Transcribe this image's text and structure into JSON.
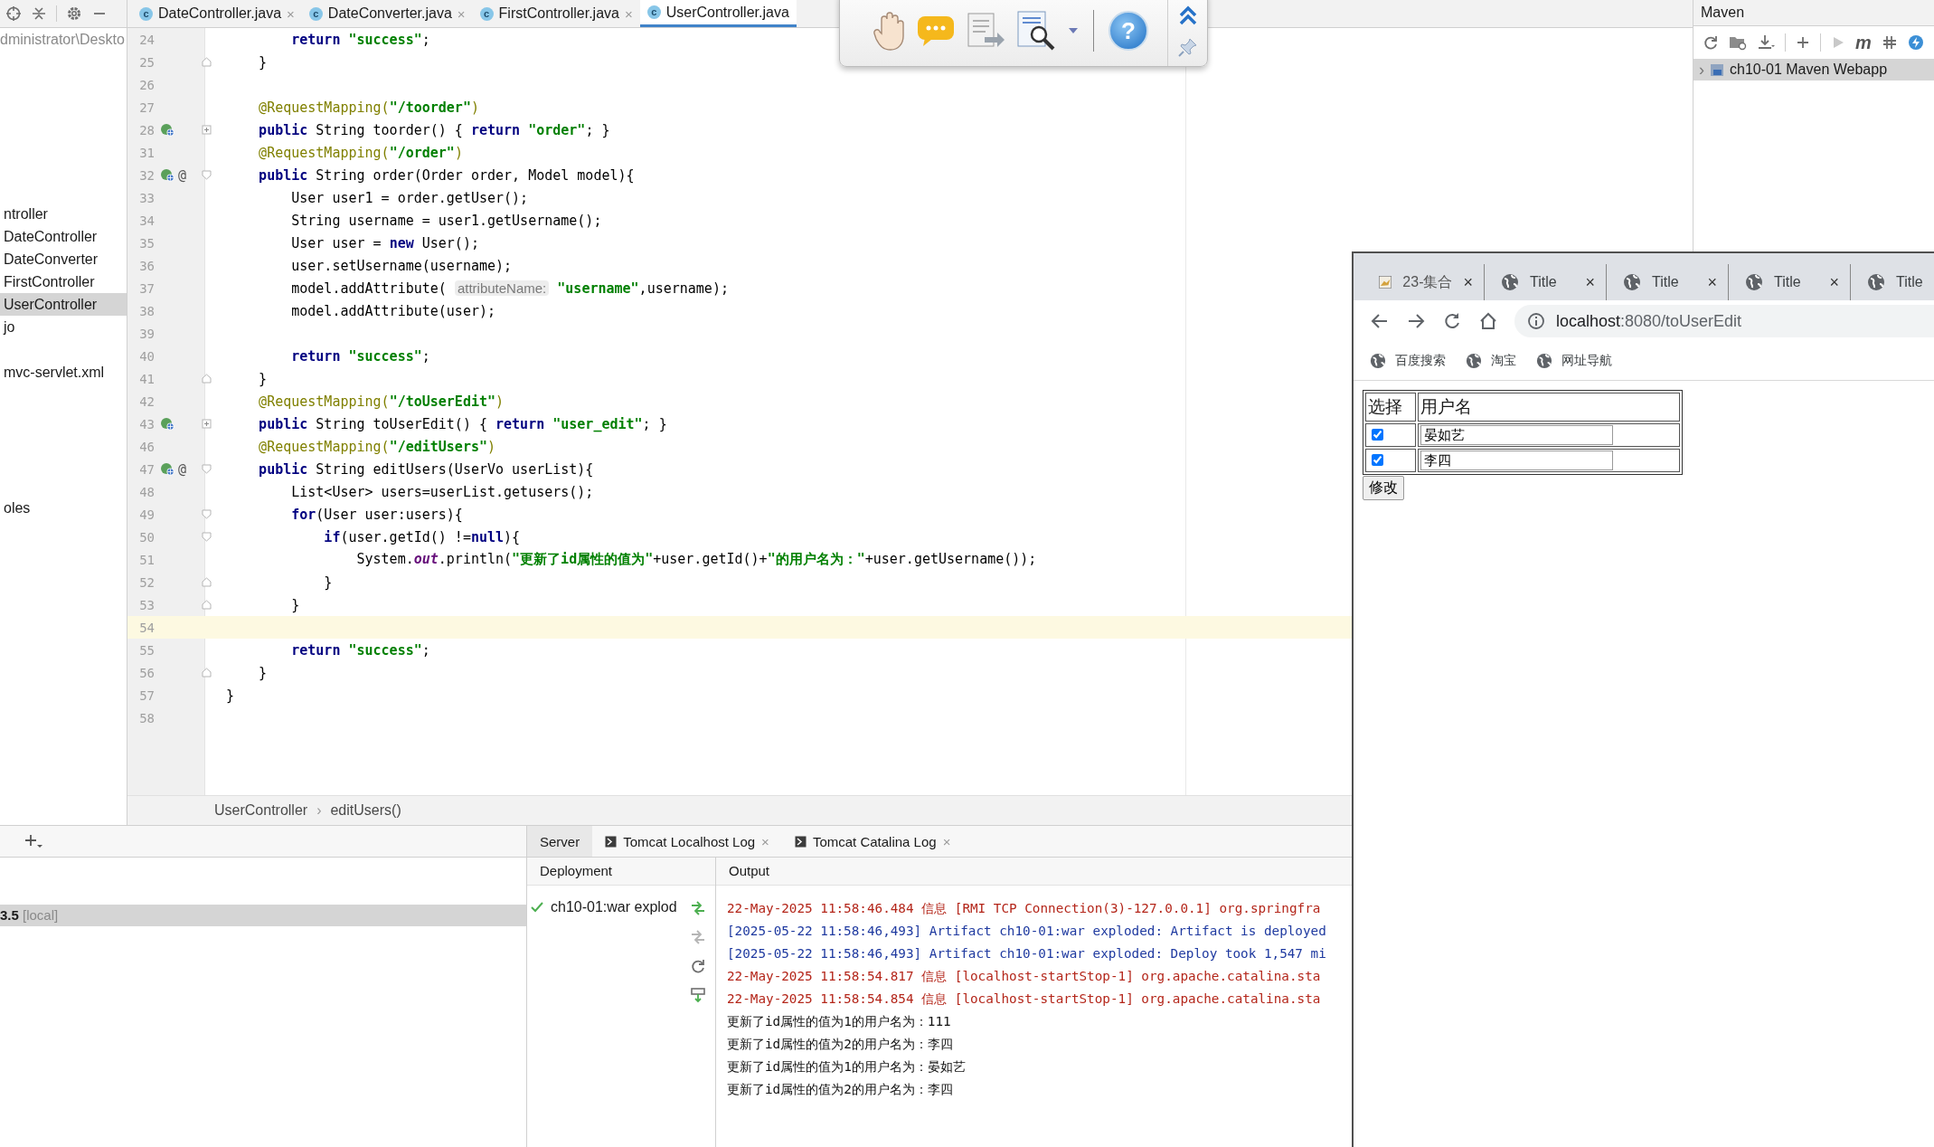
{
  "project_panel": {
    "path": "dministrator\\Deskto",
    "items": [
      {
        "label": "ntroller",
        "selected": false
      },
      {
        "label": "DateController",
        "selected": false
      },
      {
        "label": "DateConverter",
        "selected": false
      },
      {
        "label": "FirstController",
        "selected": false
      },
      {
        "label": "UserController",
        "selected": true
      },
      {
        "label": "jo",
        "selected": false
      },
      {
        "label": "mvc-servlet.xml",
        "selected": false
      },
      {
        "label": "oles",
        "selected": false
      }
    ]
  },
  "editor_tabs": [
    {
      "icon_letter": "c",
      "label": "DateController.java",
      "close": "×",
      "selected": false
    },
    {
      "icon_letter": "c",
      "label": "DateConverter.java",
      "close": "×",
      "selected": false
    },
    {
      "icon_letter": "c",
      "label": "FirstController.java",
      "close": "×",
      "selected": false
    },
    {
      "icon_letter": "c",
      "label": "UserController.java",
      "selected": true
    }
  ],
  "floating_toolbar": {
    "help": "?"
  },
  "code_lines": [
    {
      "num": "24",
      "tokens": [
        {
          "kind": "kw",
          "text": "        return "
        },
        {
          "kind": "str",
          "text": "\"success\""
        },
        {
          "kind": "plain",
          "text": ";"
        }
      ]
    },
    {
      "num": "25",
      "fold_end": true,
      "tokens": [
        {
          "kind": "plain",
          "text": "    }"
        }
      ]
    },
    {
      "num": "26"
    },
    {
      "num": "27",
      "tokens": [
        {
          "kind": "ann",
          "text": "    @RequestMapping("
        },
        {
          "kind": "str",
          "text": "\"/toorder\""
        },
        {
          "kind": "ann",
          "text": ")"
        }
      ]
    },
    {
      "num": "28",
      "bean": true,
      "collapsed": true,
      "tokens": [
        {
          "kind": "kw",
          "text": "    public "
        },
        {
          "kind": "plain",
          "text": "String toorder() { "
        },
        {
          "kind": "kw",
          "text": "return "
        },
        {
          "kind": "str",
          "text": "\"order\""
        },
        {
          "kind": "plain",
          "text": "; }"
        }
      ]
    },
    {
      "num": "31",
      "tokens": [
        {
          "kind": "ann",
          "text": "    @RequestMapping("
        },
        {
          "kind": "str",
          "text": "\"/order\""
        },
        {
          "kind": "ann",
          "text": ")"
        }
      ]
    },
    {
      "num": "32",
      "bean": true,
      "at": "@",
      "fold_start": true,
      "tokens": [
        {
          "kind": "kw",
          "text": "    public "
        },
        {
          "kind": "plain",
          "text": "String order(Order order, Model model){"
        }
      ]
    },
    {
      "num": "33",
      "tokens": [
        {
          "kind": "plain",
          "text": "        User user1 = order.getUser();"
        }
      ]
    },
    {
      "num": "34",
      "tokens": [
        {
          "kind": "plain",
          "text": "        String username = user1.getUsername();"
        }
      ]
    },
    {
      "num": "35",
      "tokens": [
        {
          "kind": "plain",
          "text": "        User user = "
        },
        {
          "kind": "kw",
          "text": "new "
        },
        {
          "kind": "plain",
          "text": "User();"
        }
      ]
    },
    {
      "num": "36",
      "tokens": [
        {
          "kind": "plain",
          "text": "        user.setUsername(username);"
        }
      ]
    },
    {
      "num": "37",
      "tokens": [
        {
          "kind": "plain",
          "text": "        model.addAttribute( "
        },
        {
          "kind": "hint",
          "text": "attributeName:"
        },
        {
          "kind": "str",
          "text": " \"username\""
        },
        {
          "kind": "plain",
          "text": ",username);"
        }
      ]
    },
    {
      "num": "38",
      "tokens": [
        {
          "kind": "plain",
          "text": "        model.addAttribute(user);"
        }
      ]
    },
    {
      "num": "39"
    },
    {
      "num": "40",
      "tokens": [
        {
          "kind": "kw",
          "text": "        return "
        },
        {
          "kind": "str",
          "text": "\"success\""
        },
        {
          "kind": "plain",
          "text": ";"
        }
      ]
    },
    {
      "num": "41",
      "fold_end": true,
      "tokens": [
        {
          "kind": "plain",
          "text": "    }"
        }
      ]
    },
    {
      "num": "42",
      "tokens": [
        {
          "kind": "ann",
          "text": "    @RequestMapping("
        },
        {
          "kind": "str",
          "text": "\"/toUserEdit\""
        },
        {
          "kind": "ann",
          "text": ")"
        }
      ]
    },
    {
      "num": "43",
      "bean": true,
      "collapsed": true,
      "tokens": [
        {
          "kind": "kw",
          "text": "    public "
        },
        {
          "kind": "plain",
          "text": "String toUserEdit() { "
        },
        {
          "kind": "kw",
          "text": "return "
        },
        {
          "kind": "str",
          "text": "\"user_edit\""
        },
        {
          "kind": "plain",
          "text": "; }"
        }
      ]
    },
    {
      "num": "46",
      "tokens": [
        {
          "kind": "ann",
          "text": "    @RequestMapping("
        },
        {
          "kind": "str",
          "text": "\"/editUsers\""
        },
        {
          "kind": "ann",
          "text": ")"
        }
      ]
    },
    {
      "num": "47",
      "bean": true,
      "at": "@",
      "fold_start": true,
      "tokens": [
        {
          "kind": "kw",
          "text": "    public "
        },
        {
          "kind": "plain",
          "text": "String editUsers(UserVo userList){"
        }
      ]
    },
    {
      "num": "48",
      "tokens": [
        {
          "kind": "plain",
          "text": "        List<User> users=userList.getusers();"
        }
      ]
    },
    {
      "num": "49",
      "fold_start": true,
      "tokens": [
        {
          "kind": "kw",
          "text": "        for"
        },
        {
          "kind": "plain",
          "text": "(User user:users){"
        }
      ]
    },
    {
      "num": "50",
      "fold_start": true,
      "tokens": [
        {
          "kind": "kw",
          "text": "            if"
        },
        {
          "kind": "plain",
          "text": "(user.getId() !="
        },
        {
          "kind": "kw",
          "text": "null"
        },
        {
          "kind": "plain",
          "text": "){"
        }
      ]
    },
    {
      "num": "51",
      "tokens": [
        {
          "kind": "plain",
          "text": "                System."
        },
        {
          "kind": "field",
          "text": "out"
        },
        {
          "kind": "plain",
          "text": ".println("
        },
        {
          "kind": "str",
          "text": "\"更新了id属性的值为\""
        },
        {
          "kind": "plain",
          "text": "+user.getId()+"
        },
        {
          "kind": "str",
          "text": "\"的用户名为：\""
        },
        {
          "kind": "plain",
          "text": "+user.getUsername());"
        }
      ]
    },
    {
      "num": "52",
      "fold_end": true,
      "tokens": [
        {
          "kind": "plain",
          "text": "            }"
        }
      ]
    },
    {
      "num": "53",
      "fold_end": true,
      "tokens": [
        {
          "kind": "plain",
          "text": "        }"
        }
      ]
    },
    {
      "num": "54",
      "current": true
    },
    {
      "num": "55",
      "tokens": [
        {
          "kind": "kw",
          "text": "        return "
        },
        {
          "kind": "str",
          "text": "\"success\""
        },
        {
          "kind": "plain",
          "text": ";"
        }
      ]
    },
    {
      "num": "56",
      "fold_end": true,
      "tokens": [
        {
          "kind": "plain",
          "text": "    }"
        }
      ]
    },
    {
      "num": "57",
      "tokens": [
        {
          "kind": "plain",
          "text": "}"
        }
      ]
    },
    {
      "num": "58"
    }
  ],
  "breadcrumbs": {
    "items": [
      "UserController",
      "editUsers()"
    ],
    "separator": "›"
  },
  "maven": {
    "title": "Maven",
    "tool_m": "m",
    "tree_item": {
      "label": "ch10-01 Maven Webapp",
      "caret": "›",
      "selected": true
    }
  },
  "services": {
    "tree_row": {
      "label": "3.5",
      "suffix": "[local]",
      "selected": true
    }
  },
  "server_tabs": [
    {
      "label": "Server",
      "selected": true
    },
    {
      "label": "Tomcat Localhost Log",
      "close": "×",
      "selected": false
    },
    {
      "label": "Tomcat Catalina Log",
      "close": "×",
      "selected": false
    }
  ],
  "deployment": {
    "header": "Deployment",
    "item": "ch10-01:war explod"
  },
  "output": {
    "header": "Output",
    "lines": [
      {
        "kind": "log",
        "text": "22-May-2025 11:58:46.484 信息 [RMI TCP Connection(3)-127.0.0.1] org.springfra"
      },
      {
        "kind": "artifact",
        "text": "[2025-05-22 11:58:46,493] Artifact ch10-01:war exploded: Artifact is deployed"
      },
      {
        "kind": "artifact",
        "text": "[2025-05-22 11:58:46,493] Artifact ch10-01:war exploded: Deploy took 1,547 mi"
      },
      {
        "kind": "log",
        "text": "22-May-2025 11:58:54.817 信息 [localhost-startStop-1] org.apache.catalina.sta"
      },
      {
        "kind": "log",
        "text": "22-May-2025 11:58:54.854 信息 [localhost-startStop-1] org.apache.catalina.sta"
      },
      {
        "kind": "out",
        "text": "更新了id属性的值为1的用户名为：111"
      },
      {
        "kind": "out",
        "text": "更新了id属性的值为2的用户名为：李四"
      },
      {
        "kind": "out",
        "text": "更新了id属性的值为1的用户名为：晏如艺"
      },
      {
        "kind": "out",
        "text": "更新了id属性的值为2的用户名为：李四"
      }
    ]
  },
  "browser": {
    "tabs": [
      {
        "kind": "app",
        "label": "23-集合",
        "close": "×"
      },
      {
        "kind": "globe",
        "label": "Title",
        "close": "×"
      },
      {
        "kind": "globe",
        "label": "Title",
        "close": "×"
      },
      {
        "kind": "globe",
        "label": "Title",
        "close": "×"
      },
      {
        "kind": "globe",
        "label": "Title"
      }
    ],
    "url_host": "localhost",
    "url_path": ":8080/toUserEdit",
    "bookmarks": [
      "百度搜索",
      "淘宝",
      "网址导航"
    ],
    "page": {
      "headers": [
        "选择",
        "用户名"
      ],
      "rows": [
        {
          "checked": true,
          "username": "晏如艺"
        },
        {
          "checked": true,
          "username": "李四"
        }
      ],
      "submit": "修改"
    }
  }
}
